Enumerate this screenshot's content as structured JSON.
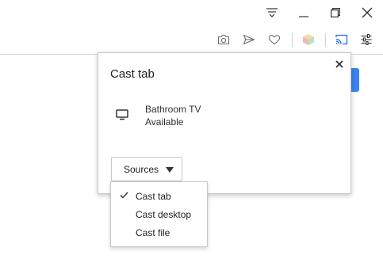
{
  "window_controls": {
    "tab_search_icon": "tab-search",
    "minimize_icon": "minimize",
    "restore_icon": "restore",
    "close_icon": "close"
  },
  "toolbar": {
    "icons": [
      "camera",
      "send",
      "heart",
      "extension-cube",
      "cast",
      "settings-sliders"
    ],
    "cast_active_color": "#1a73e8"
  },
  "cast_popup": {
    "title": "Cast tab",
    "sink": {
      "name": "Bathroom TV",
      "status": "Available",
      "icon": "monitor"
    },
    "sources_label": "Sources"
  },
  "sources_menu": {
    "items": [
      {
        "label": "Cast tab",
        "checked": true
      },
      {
        "label": "Cast desktop",
        "checked": false
      },
      {
        "label": "Cast file",
        "checked": false
      }
    ]
  },
  "colors": {
    "accent": "#3b82f0"
  }
}
